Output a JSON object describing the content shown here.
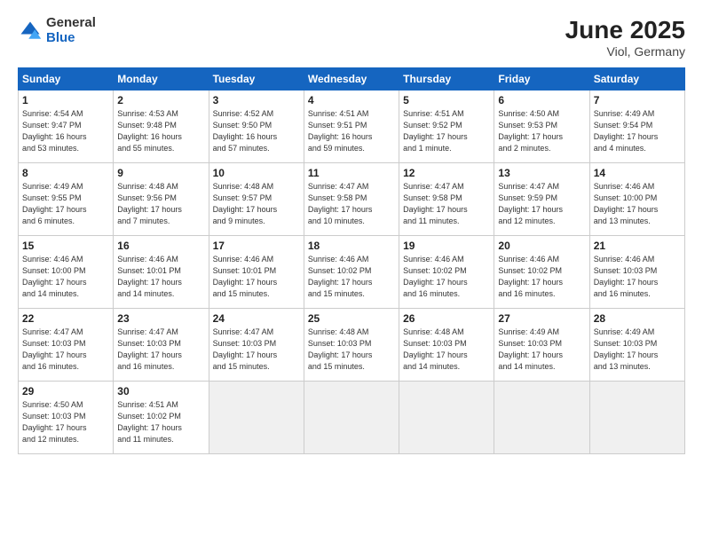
{
  "header": {
    "logo_general": "General",
    "logo_blue": "Blue",
    "title": "June 2025",
    "location": "Viol, Germany"
  },
  "days_of_week": [
    "Sunday",
    "Monday",
    "Tuesday",
    "Wednesday",
    "Thursday",
    "Friday",
    "Saturday"
  ],
  "weeks": [
    [
      {
        "num": "1",
        "info": "Sunrise: 4:54 AM\nSunset: 9:47 PM\nDaylight: 16 hours\nand 53 minutes."
      },
      {
        "num": "2",
        "info": "Sunrise: 4:53 AM\nSunset: 9:48 PM\nDaylight: 16 hours\nand 55 minutes."
      },
      {
        "num": "3",
        "info": "Sunrise: 4:52 AM\nSunset: 9:50 PM\nDaylight: 16 hours\nand 57 minutes."
      },
      {
        "num": "4",
        "info": "Sunrise: 4:51 AM\nSunset: 9:51 PM\nDaylight: 16 hours\nand 59 minutes."
      },
      {
        "num": "5",
        "info": "Sunrise: 4:51 AM\nSunset: 9:52 PM\nDaylight: 17 hours\nand 1 minute."
      },
      {
        "num": "6",
        "info": "Sunrise: 4:50 AM\nSunset: 9:53 PM\nDaylight: 17 hours\nand 2 minutes."
      },
      {
        "num": "7",
        "info": "Sunrise: 4:49 AM\nSunset: 9:54 PM\nDaylight: 17 hours\nand 4 minutes."
      }
    ],
    [
      {
        "num": "8",
        "info": "Sunrise: 4:49 AM\nSunset: 9:55 PM\nDaylight: 17 hours\nand 6 minutes."
      },
      {
        "num": "9",
        "info": "Sunrise: 4:48 AM\nSunset: 9:56 PM\nDaylight: 17 hours\nand 7 minutes."
      },
      {
        "num": "10",
        "info": "Sunrise: 4:48 AM\nSunset: 9:57 PM\nDaylight: 17 hours\nand 9 minutes."
      },
      {
        "num": "11",
        "info": "Sunrise: 4:47 AM\nSunset: 9:58 PM\nDaylight: 17 hours\nand 10 minutes."
      },
      {
        "num": "12",
        "info": "Sunrise: 4:47 AM\nSunset: 9:58 PM\nDaylight: 17 hours\nand 11 minutes."
      },
      {
        "num": "13",
        "info": "Sunrise: 4:47 AM\nSunset: 9:59 PM\nDaylight: 17 hours\nand 12 minutes."
      },
      {
        "num": "14",
        "info": "Sunrise: 4:46 AM\nSunset: 10:00 PM\nDaylight: 17 hours\nand 13 minutes."
      }
    ],
    [
      {
        "num": "15",
        "info": "Sunrise: 4:46 AM\nSunset: 10:00 PM\nDaylight: 17 hours\nand 14 minutes."
      },
      {
        "num": "16",
        "info": "Sunrise: 4:46 AM\nSunset: 10:01 PM\nDaylight: 17 hours\nand 14 minutes."
      },
      {
        "num": "17",
        "info": "Sunrise: 4:46 AM\nSunset: 10:01 PM\nDaylight: 17 hours\nand 15 minutes."
      },
      {
        "num": "18",
        "info": "Sunrise: 4:46 AM\nSunset: 10:02 PM\nDaylight: 17 hours\nand 15 minutes."
      },
      {
        "num": "19",
        "info": "Sunrise: 4:46 AM\nSunset: 10:02 PM\nDaylight: 17 hours\nand 16 minutes."
      },
      {
        "num": "20",
        "info": "Sunrise: 4:46 AM\nSunset: 10:02 PM\nDaylight: 17 hours\nand 16 minutes."
      },
      {
        "num": "21",
        "info": "Sunrise: 4:46 AM\nSunset: 10:03 PM\nDaylight: 17 hours\nand 16 minutes."
      }
    ],
    [
      {
        "num": "22",
        "info": "Sunrise: 4:47 AM\nSunset: 10:03 PM\nDaylight: 17 hours\nand 16 minutes."
      },
      {
        "num": "23",
        "info": "Sunrise: 4:47 AM\nSunset: 10:03 PM\nDaylight: 17 hours\nand 16 minutes."
      },
      {
        "num": "24",
        "info": "Sunrise: 4:47 AM\nSunset: 10:03 PM\nDaylight: 17 hours\nand 15 minutes."
      },
      {
        "num": "25",
        "info": "Sunrise: 4:48 AM\nSunset: 10:03 PM\nDaylight: 17 hours\nand 15 minutes."
      },
      {
        "num": "26",
        "info": "Sunrise: 4:48 AM\nSunset: 10:03 PM\nDaylight: 17 hours\nand 14 minutes."
      },
      {
        "num": "27",
        "info": "Sunrise: 4:49 AM\nSunset: 10:03 PM\nDaylight: 17 hours\nand 14 minutes."
      },
      {
        "num": "28",
        "info": "Sunrise: 4:49 AM\nSunset: 10:03 PM\nDaylight: 17 hours\nand 13 minutes."
      }
    ],
    [
      {
        "num": "29",
        "info": "Sunrise: 4:50 AM\nSunset: 10:03 PM\nDaylight: 17 hours\nand 12 minutes."
      },
      {
        "num": "30",
        "info": "Sunrise: 4:51 AM\nSunset: 10:02 PM\nDaylight: 17 hours\nand 11 minutes."
      },
      {
        "num": "",
        "info": ""
      },
      {
        "num": "",
        "info": ""
      },
      {
        "num": "",
        "info": ""
      },
      {
        "num": "",
        "info": ""
      },
      {
        "num": "",
        "info": ""
      }
    ]
  ]
}
